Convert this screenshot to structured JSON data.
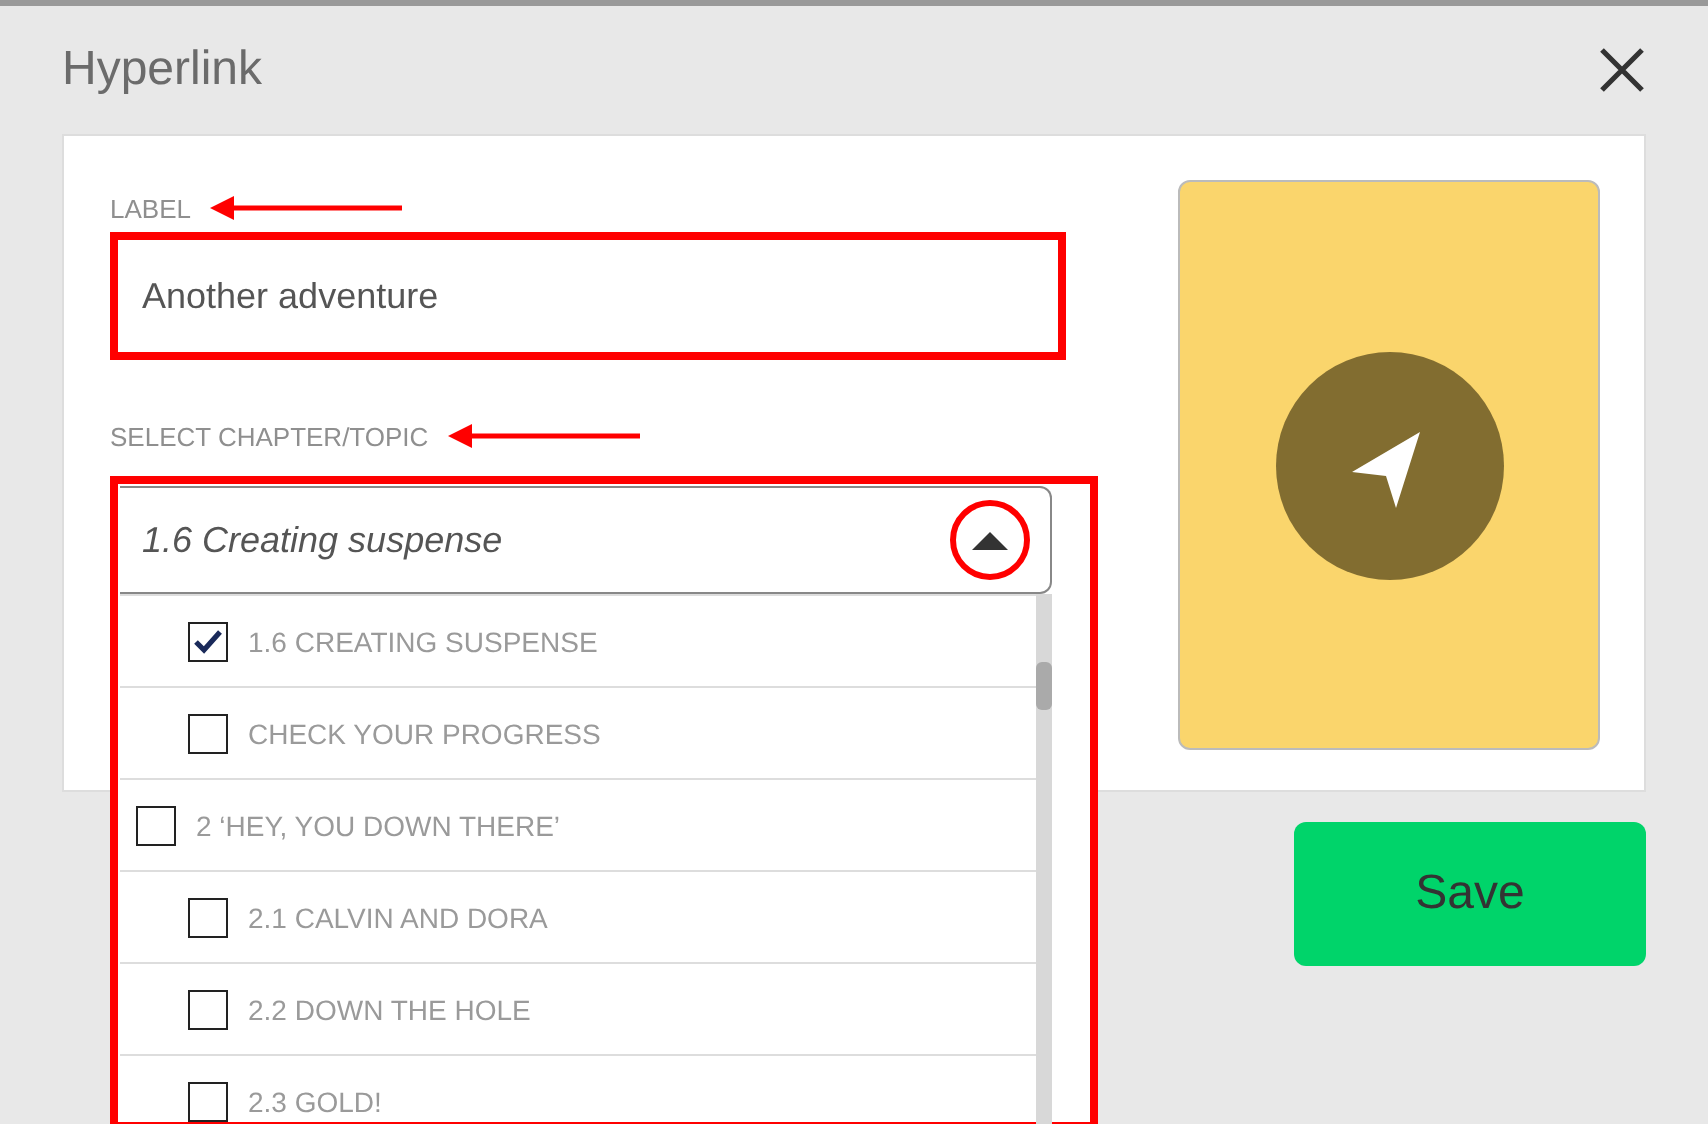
{
  "dialog": {
    "title": "Hyperlink"
  },
  "label_field": {
    "label": "LABEL",
    "value": "Another adventure",
    "highlighted": true,
    "arrow": true
  },
  "chapter_select": {
    "label": "SELECT CHAPTER/TOPIC",
    "value": "1.6 Creating suspense",
    "expanded": true,
    "highlighted": true,
    "arrow": true,
    "caret_circled": true,
    "options": [
      {
        "children": [
          {
            "label": "1.6 CREATING SUSPENSE",
            "checked": true
          },
          {
            "label": "CHECK YOUR PROGRESS",
            "checked": false
          }
        ]
      },
      {
        "label": "2 ‘HEY, YOU DOWN THERE’",
        "checked": false,
        "children": [
          {
            "label": "2.1 CALVIN AND DORA",
            "checked": false
          },
          {
            "label": "2.2 DOWN THE HOLE",
            "checked": false
          },
          {
            "label": "2.3 GOLD!",
            "checked": false
          }
        ]
      }
    ]
  },
  "save_button": {
    "label": "Save"
  }
}
